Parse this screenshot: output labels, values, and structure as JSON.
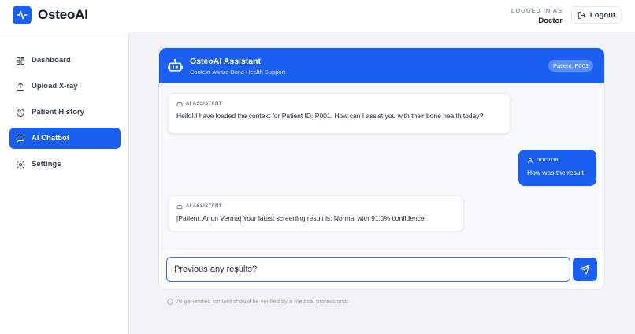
{
  "app": {
    "name": "OsteoAI",
    "accent": "#1a5ff0"
  },
  "header": {
    "logged_in_label": "LOGGED IN AS",
    "user_role": "Doctor",
    "logout_label": "Logout"
  },
  "sidebar": {
    "items": [
      {
        "label": "Dashboard",
        "icon": "grid-icon",
        "active": false
      },
      {
        "label": "Upload X-ray",
        "icon": "upload-icon",
        "active": false
      },
      {
        "label": "Patient History",
        "icon": "history-icon",
        "active": false
      },
      {
        "label": "AI Chatbot",
        "icon": "chat-icon",
        "active": true
      },
      {
        "label": "Settings",
        "icon": "gear-icon",
        "active": false
      }
    ]
  },
  "chat": {
    "title": "OsteoAI Assistant",
    "subtitle": "Context-Aware Bone Health Support",
    "patient_badge": "Patient: P001",
    "messages": [
      {
        "role": "AI ASSISTANT",
        "from": "assistant",
        "text": "Hello! I have loaded the context for Patient ID: P001. How can I assist you with their bone health today?"
      },
      {
        "role": "DOCTOR",
        "from": "user",
        "text": "How was the result"
      },
      {
        "role": "AI ASSISTANT",
        "from": "assistant",
        "text": "[Patient: Arjun Verma] Your latest screening result is: Normal with 91.0% confidence."
      }
    ],
    "input_value": "Previous any results?",
    "disclaimer": "AI-generated content should be verified by a medical professional."
  }
}
